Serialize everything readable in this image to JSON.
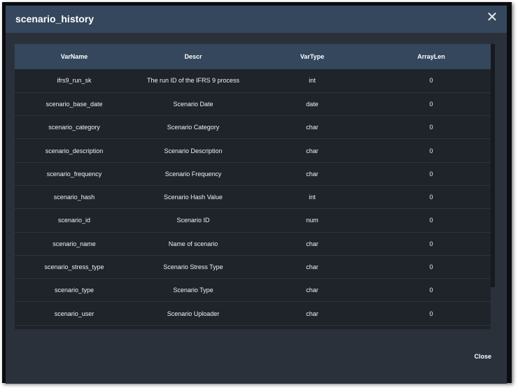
{
  "dialog": {
    "title": "scenario_history",
    "close_icon_glyph": "✕",
    "close_label": "Close"
  },
  "table": {
    "columns": [
      "VarName",
      "Descr",
      "VarType",
      "ArrayLen"
    ],
    "rows": [
      [
        "ifrs9_run_sk",
        "The run ID of the IFRS 9 process",
        "int",
        "0"
      ],
      [
        "scenario_base_date",
        "Scenario Date",
        "date",
        "0"
      ],
      [
        "scenario_category",
        "Scenario Category",
        "char",
        "0"
      ],
      [
        "scenario_description",
        "Scenario Description",
        "char",
        "0"
      ],
      [
        "scenario_frequency",
        "Scenario Frequency",
        "char",
        "0"
      ],
      [
        "scenario_hash",
        "Scenario Hash Value",
        "int",
        "0"
      ],
      [
        "scenario_id",
        "Scenario ID",
        "num",
        "0"
      ],
      [
        "scenario_name",
        "Name of scenario",
        "char",
        "0"
      ],
      [
        "scenario_stress_type",
        "Scenario Stress Type",
        "char",
        "0"
      ],
      [
        "scenario_type",
        "Scenario Type",
        "char",
        "0"
      ],
      [
        "scenario_user",
        "Scenario Uploader",
        "char",
        "0"
      ]
    ]
  },
  "colors": {
    "header_bg": "#34475d",
    "dialog_bg": "#2b313b",
    "table_bg": "#1f232a"
  }
}
